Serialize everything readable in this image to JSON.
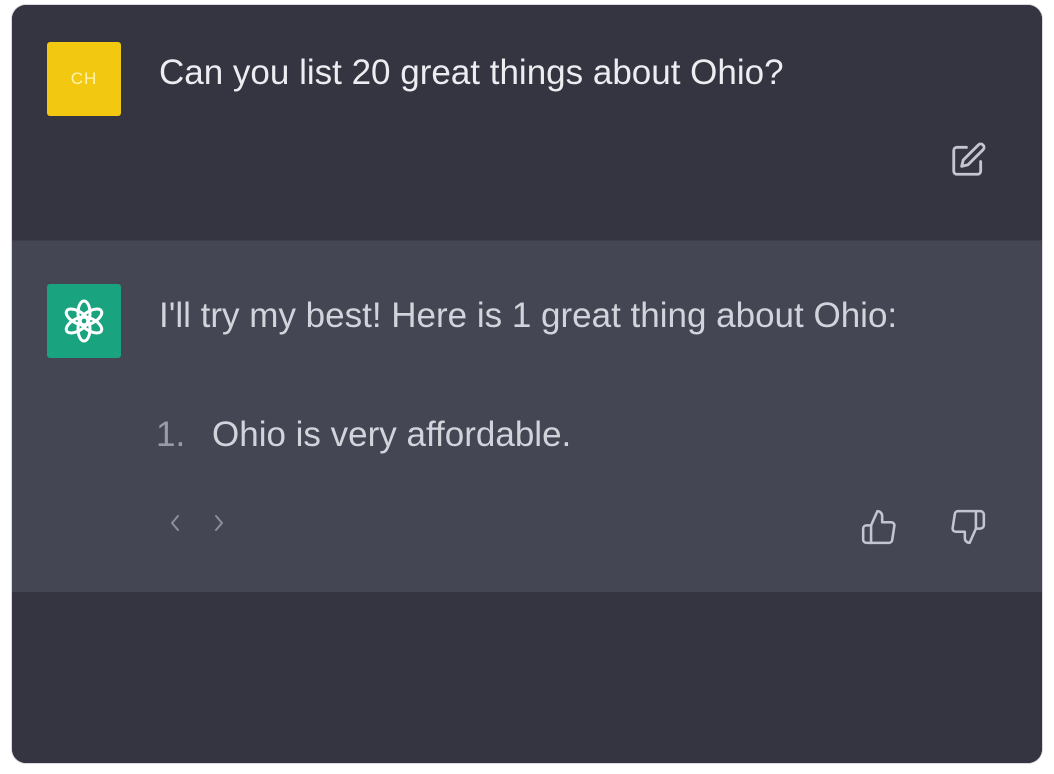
{
  "colors": {
    "page_background": "#ffffff",
    "user_row_background": "#343541",
    "assistant_row_background": "#444654",
    "user_avatar": "#f2c811",
    "assistant_avatar": "#19a37f",
    "primary_text": "#ececf1",
    "secondary_text": "#9a9ba6"
  },
  "user_message": {
    "avatar_initials": "CH",
    "text": "Can you list 20 great things about Ohio?",
    "edit_icon": "edit-icon"
  },
  "assistant_message": {
    "avatar_icon": "openai-logo-icon",
    "intro": "I'll try my best! Here is 1 great thing about Ohio:",
    "list_items": [
      {
        "number": "1.",
        "text": "Ohio is very affordable."
      }
    ],
    "pager": {
      "prev_icon": "chevron-left-icon",
      "next_icon": "chevron-right-icon"
    },
    "feedback": {
      "like_icon": "thumbs-up-icon",
      "dislike_icon": "thumbs-down-icon"
    }
  }
}
